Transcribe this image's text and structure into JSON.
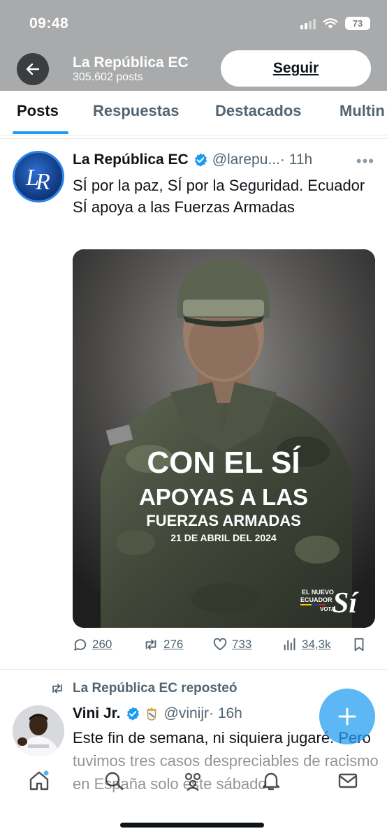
{
  "status_bar": {
    "time": "09:48",
    "battery": "73"
  },
  "header": {
    "title": "La República EC",
    "posts_count": "305.602 posts",
    "follow_label": "Seguir"
  },
  "tabs": [
    {
      "label": "Posts",
      "active": true
    },
    {
      "label": "Respuestas",
      "active": false
    },
    {
      "label": "Destacados",
      "active": false
    },
    {
      "label": "Multin",
      "active": false
    }
  ],
  "tweet1": {
    "author_name": "La República EC",
    "handle": "@larepu...",
    "time": "· 11h",
    "text": "SÍ por la paz, SÍ por la Seguridad. Ecuador SÍ apoya a las Fuerzas Armadas",
    "media": {
      "headline_1": "CON EL SÍ",
      "headline_2": "APOYAS A LAS",
      "headline_3": "FUERZAS ARMADAS",
      "date": "21 DE ABRIL DEL 2024",
      "logo_1": "EL NUEVO",
      "logo_2": "ECUADOR",
      "logo_3": "VOTA",
      "logo_si": "Sí"
    },
    "stats": {
      "replies": "260",
      "reposts": "276",
      "likes": "733",
      "views": "34,3k"
    }
  },
  "tweet2": {
    "repost_label": "La República EC reposteó",
    "author_name": "Vini Jr.",
    "handle": "@vinijr",
    "time": "· 16h",
    "text": "Este fin de semana, ni siquiera jugaré. Pero tuvimos tres casos despreciables de racismo en España solo este sábado."
  },
  "colors": {
    "accent": "#1d9bf0",
    "text": "#0f1419",
    "secondary": "#536471"
  }
}
